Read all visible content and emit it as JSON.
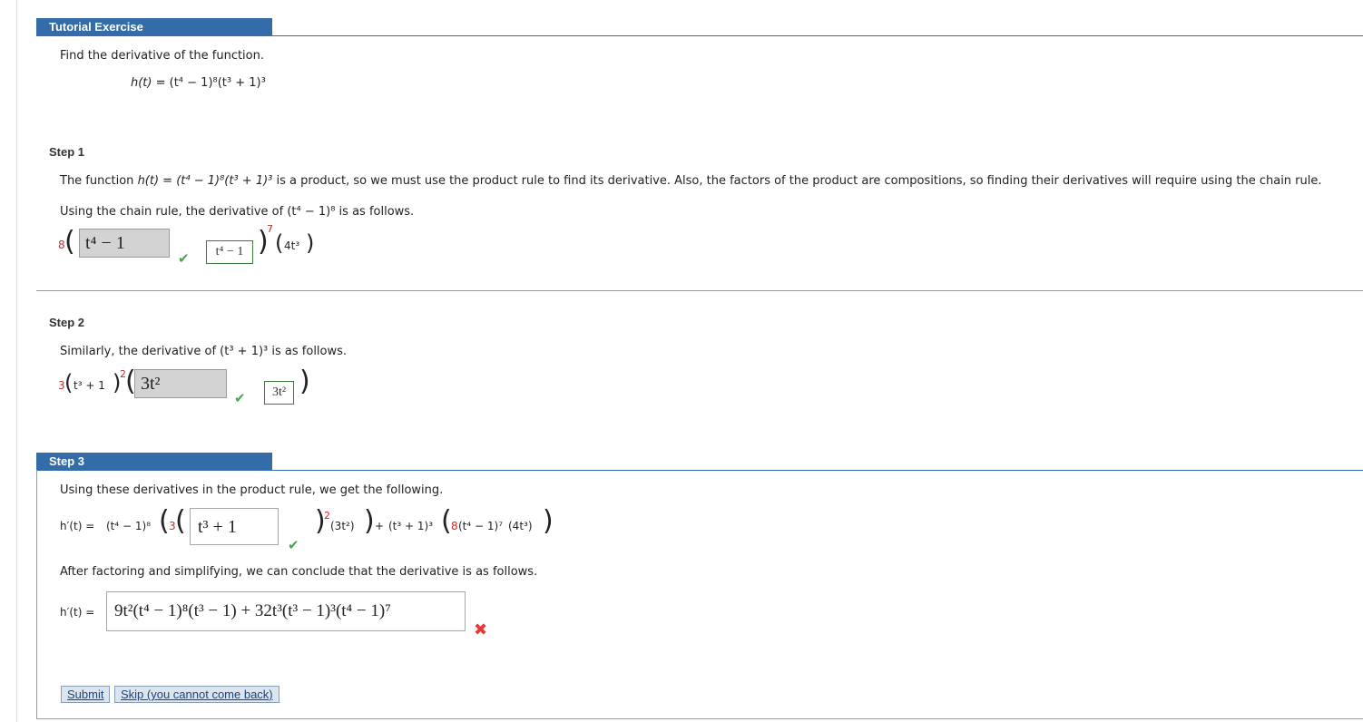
{
  "header": {
    "title": "Tutorial Exercise"
  },
  "problem": {
    "instruction": "Find the derivative of the function.",
    "function_lhs": "h(t) = ",
    "function_rhs": "(t⁴ − 1)⁸(t³ + 1)³"
  },
  "step1": {
    "label": "Step 1",
    "text_a": "The function ",
    "text_fn": "h(t) = (t⁴ − 1)⁸(t³ + 1)³",
    "text_b": " is a product, so we must use the product rule to find its derivative. Also, the factors of the product are compositions, so finding their derivatives will require using the chain rule.",
    "chain_text_a": "Using the chain rule, the derivative of ",
    "chain_expr": "(t⁴ − 1)⁸",
    "chain_text_b": " is as follows.",
    "coef": "8",
    "answer_input": "t⁴ − 1",
    "correct_answer": "t⁴ − 1",
    "exponent": "7",
    "tail": "4t³"
  },
  "step2": {
    "label": "Step 2",
    "text_a": "Similarly, the derivative of ",
    "expr": "(t³ + 1)³",
    "text_b": " is as follows.",
    "coef": "3",
    "inner": "t³ + 1",
    "exponent": "2",
    "answer_input": "3t²",
    "correct_answer": "3t²"
  },
  "step3": {
    "label": "Step 3",
    "intro": "Using these derivatives in the product rule, we get the following.",
    "hprime_lhs": "h′(t) = ",
    "part_a": "(t⁴ − 1)⁸",
    "coef3": "3",
    "answer_input": "t³ + 1",
    "exp2": "2",
    "part_b": "(3t²)",
    "plus": " + ",
    "part_c": "(t³ + 1)³",
    "coef8": "8",
    "part_d": "(t⁴ − 1)⁷",
    "part_e": "(4t³)",
    "conclude": "After factoring and simplifying, we can conclude that the derivative is as follows.",
    "final_lhs": "h′(t) = ",
    "final_answer": "9t²(t⁴ − 1)⁸(t³ − 1) + 32t³(t³ − 1)³(t⁴ − 1)⁷"
  },
  "buttons": {
    "submit": "Submit",
    "skip": "Skip (you cannot come back)"
  },
  "colors": {
    "header_blue": "#336ca8",
    "correct_green": "#4aa64a",
    "wrong_red": "#e03b3b",
    "coef_red": "#d12a2a"
  },
  "icons": {
    "correct": "checkmark-icon",
    "incorrect": "x-mark-icon"
  }
}
